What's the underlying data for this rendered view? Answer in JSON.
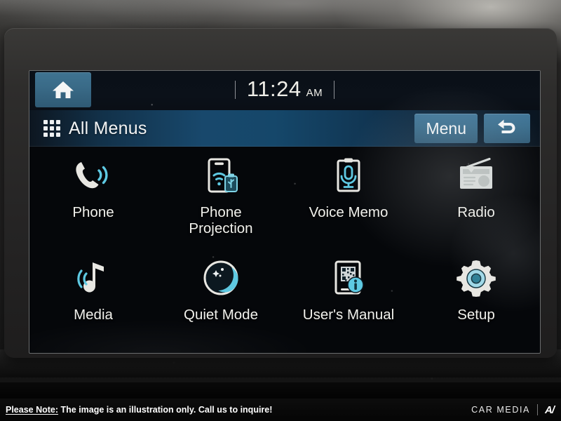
{
  "device": {
    "type": "car-infotainment-head-unit"
  },
  "statusbar": {
    "home_icon": "home-icon",
    "time": "11:24",
    "meridiem": "AM"
  },
  "titlebar": {
    "grid_icon": "grid-icon",
    "title": "All Menus",
    "menu_label": "Menu",
    "back_icon": "back-arrow-icon"
  },
  "apps": [
    {
      "label": "Phone",
      "icon": "phone-handset-icon"
    },
    {
      "label": "Phone\nProjection",
      "label_line1": "Phone",
      "label_line2": "Projection",
      "icon": "phone-projection-icon"
    },
    {
      "label": "Voice Memo",
      "icon": "voice-memo-microphone-icon"
    },
    {
      "label": "Radio",
      "icon": "radio-icon"
    },
    {
      "label": "Media",
      "icon": "music-note-icon"
    },
    {
      "label": "Quiet Mode",
      "icon": "crescent-moon-icon"
    },
    {
      "label": "User's Manual",
      "icon": "manual-qr-info-icon"
    },
    {
      "label": "Setup",
      "icon": "gear-icon"
    }
  ],
  "footer": {
    "note_label": "Please Note:",
    "note_text": "The image is an illustration only. Call us to inquire!",
    "brand_text": "CAR MEDIA",
    "brand_mark": "A/"
  },
  "colors": {
    "accent_cyan": "#57c7e0",
    "button_blue": "#3c6f8e",
    "title_blue": "#18486c",
    "screen_black": "#05070a",
    "text_white": "#f1f1ec"
  }
}
